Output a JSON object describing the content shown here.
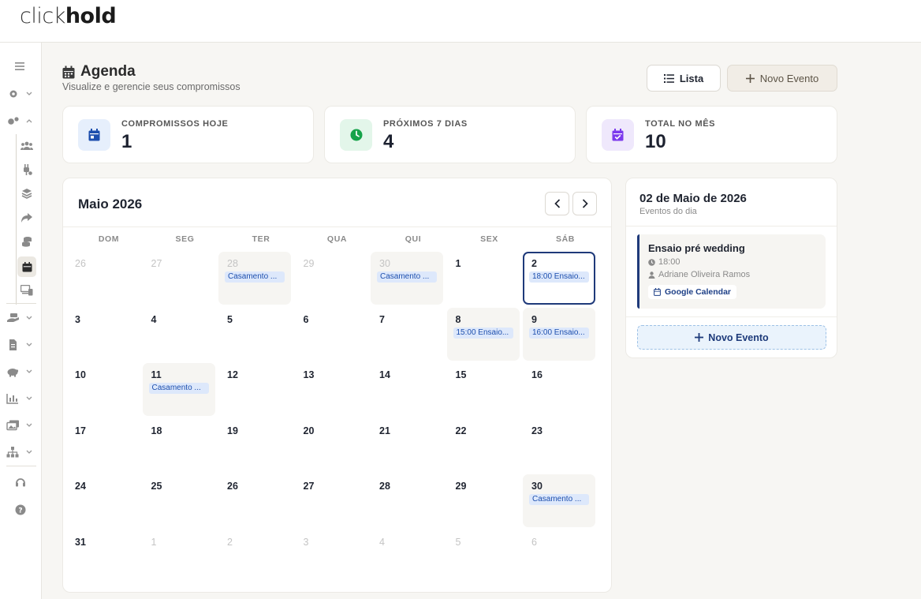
{
  "app": {
    "logo_light": "click",
    "logo_bold": "hold"
  },
  "header": {
    "title": "Agenda",
    "subtitle": "Visualize e gerencie seus compromissos",
    "list_button": "Lista",
    "new_event_button": "Novo Evento"
  },
  "stats": [
    {
      "label": "COMPROMISSOS HOJE",
      "value": "1",
      "icon": "calendar-icon",
      "color": "#1d4fae",
      "bg": "#e6effc"
    },
    {
      "label": "PRÓXIMOS 7 DIAS",
      "value": "4",
      "icon": "clock-icon",
      "color": "#16a34a",
      "bg": "#e3f6ea"
    },
    {
      "label": "TOTAL NO MÊS",
      "value": "10",
      "icon": "calendar-check-icon",
      "color": "#7c3aed",
      "bg": "#efe8fc"
    }
  ],
  "calendar": {
    "month_label": "Maio 2026",
    "weekdays": [
      "DOM",
      "SEG",
      "TER",
      "QUA",
      "QUI",
      "SEX",
      "SÁB"
    ],
    "days": [
      {
        "num": "26",
        "other": true,
        "event": ""
      },
      {
        "num": "27",
        "other": true,
        "event": ""
      },
      {
        "num": "28",
        "other": true,
        "event": "Casamento ..."
      },
      {
        "num": "29",
        "other": true,
        "event": ""
      },
      {
        "num": "30",
        "other": true,
        "event": "Casamento ..."
      },
      {
        "num": "1",
        "other": false,
        "event": ""
      },
      {
        "num": "2",
        "other": false,
        "event": "18:00 Ensaio...",
        "selected": true
      },
      {
        "num": "3",
        "other": false,
        "event": ""
      },
      {
        "num": "4",
        "other": false,
        "event": ""
      },
      {
        "num": "5",
        "other": false,
        "event": ""
      },
      {
        "num": "6",
        "other": false,
        "event": ""
      },
      {
        "num": "7",
        "other": false,
        "event": ""
      },
      {
        "num": "8",
        "other": false,
        "event": "15:00 Ensaio..."
      },
      {
        "num": "9",
        "other": false,
        "event": "16:00 Ensaio..."
      },
      {
        "num": "10",
        "other": false,
        "event": ""
      },
      {
        "num": "11",
        "other": false,
        "event": "Casamento ..."
      },
      {
        "num": "12",
        "other": false,
        "event": ""
      },
      {
        "num": "13",
        "other": false,
        "event": ""
      },
      {
        "num": "14",
        "other": false,
        "event": ""
      },
      {
        "num": "15",
        "other": false,
        "event": ""
      },
      {
        "num": "16",
        "other": false,
        "event": ""
      },
      {
        "num": "17",
        "other": false,
        "event": ""
      },
      {
        "num": "18",
        "other": false,
        "event": ""
      },
      {
        "num": "19",
        "other": false,
        "event": ""
      },
      {
        "num": "20",
        "other": false,
        "event": ""
      },
      {
        "num": "21",
        "other": false,
        "event": ""
      },
      {
        "num": "22",
        "other": false,
        "event": ""
      },
      {
        "num": "23",
        "other": false,
        "event": ""
      },
      {
        "num": "24",
        "other": false,
        "event": ""
      },
      {
        "num": "25",
        "other": false,
        "event": ""
      },
      {
        "num": "26",
        "other": false,
        "event": ""
      },
      {
        "num": "27",
        "other": false,
        "event": ""
      },
      {
        "num": "28",
        "other": false,
        "event": ""
      },
      {
        "num": "29",
        "other": false,
        "event": ""
      },
      {
        "num": "30",
        "other": false,
        "event": "Casamento ..."
      },
      {
        "num": "31",
        "other": false,
        "event": ""
      },
      {
        "num": "1",
        "other": true,
        "event": ""
      },
      {
        "num": "2",
        "other": true,
        "event": ""
      },
      {
        "num": "3",
        "other": true,
        "event": ""
      },
      {
        "num": "4",
        "other": true,
        "event": ""
      },
      {
        "num": "5",
        "other": true,
        "event": ""
      },
      {
        "num": "6",
        "other": true,
        "event": ""
      }
    ]
  },
  "day_panel": {
    "title": "02 de Maio de 2026",
    "subtitle": "Eventos do dia",
    "event": {
      "title": "Ensaio pré wedding",
      "time": "18:00",
      "client": "Adriane Oliveira Ramos",
      "source": "Google Calendar"
    },
    "new_event_button": "Novo Evento"
  },
  "colors": {
    "accent_navy": "#1f3a7a",
    "chip_bg": "#dde8fb",
    "chip_text": "#1d4fae"
  }
}
